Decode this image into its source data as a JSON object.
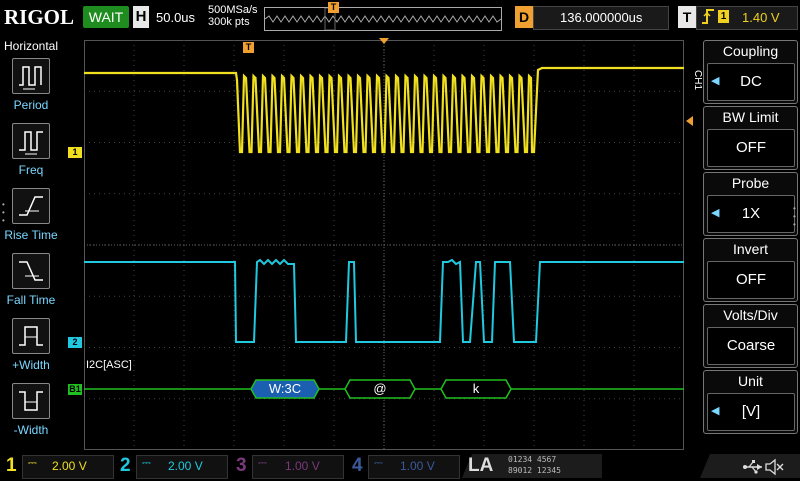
{
  "topbar": {
    "logo": "RIGOL",
    "status": "WAIT",
    "h_label": "H",
    "timebase": "50.0us",
    "sample_rate": "500MSa/s",
    "mem_depth": "300k pts",
    "trigger_pos_marker": "T",
    "d_label": "D",
    "delay": "136.000000us",
    "t_label": "T",
    "trigger_edge": "rising-edge-icon",
    "trigger_channel": "1",
    "trigger_level": "1.40 V"
  },
  "left_menu": {
    "title": "Horizontal",
    "items": [
      {
        "label": "Period",
        "icon": "period-icon"
      },
      {
        "label": "Freq",
        "icon": "freq-icon"
      },
      {
        "label": "Rise Time",
        "icon": "rise-time-icon"
      },
      {
        "label": "Fall Time",
        "icon": "fall-time-icon"
      },
      {
        "label": "+Width",
        "icon": "plus-width-icon"
      },
      {
        "label": "-Width",
        "icon": "minus-width-icon"
      }
    ]
  },
  "right_menu": {
    "channel_tag": "CH1",
    "items": [
      {
        "title": "Coupling",
        "value": "DC"
      },
      {
        "title": "BW Limit",
        "value": "OFF"
      },
      {
        "title": "Probe",
        "value": "1X"
      },
      {
        "title": "Invert",
        "value": "OFF"
      },
      {
        "title": "Volts/Div",
        "value": "Coarse"
      },
      {
        "title": "Unit",
        "value": "[V]"
      }
    ]
  },
  "decode": {
    "label": "I2C[ASC]",
    "marker": "B1",
    "frames": [
      "W:3C",
      "@",
      "k"
    ]
  },
  "channel_markers": {
    "ch1": "1",
    "ch2": "2"
  },
  "bottombar": {
    "channels": [
      {
        "num": "1",
        "scale": "2.00 V",
        "color": "#f0e020"
      },
      {
        "num": "2",
        "scale": "2.00 V",
        "color": "#20c8e0"
      },
      {
        "num": "3",
        "scale": "1.00 V",
        "color": "#c050c0"
      },
      {
        "num": "4",
        "scale": "1.00 V",
        "color": "#3080f0"
      }
    ],
    "la_label": "LA",
    "la_row1": "01234 4567",
    "la_row2": "89012 12345"
  },
  "colors": {
    "ch1": "#f0e020",
    "ch2": "#20c8e0",
    "decode": "#20c020",
    "accent": "#f0a030"
  }
}
